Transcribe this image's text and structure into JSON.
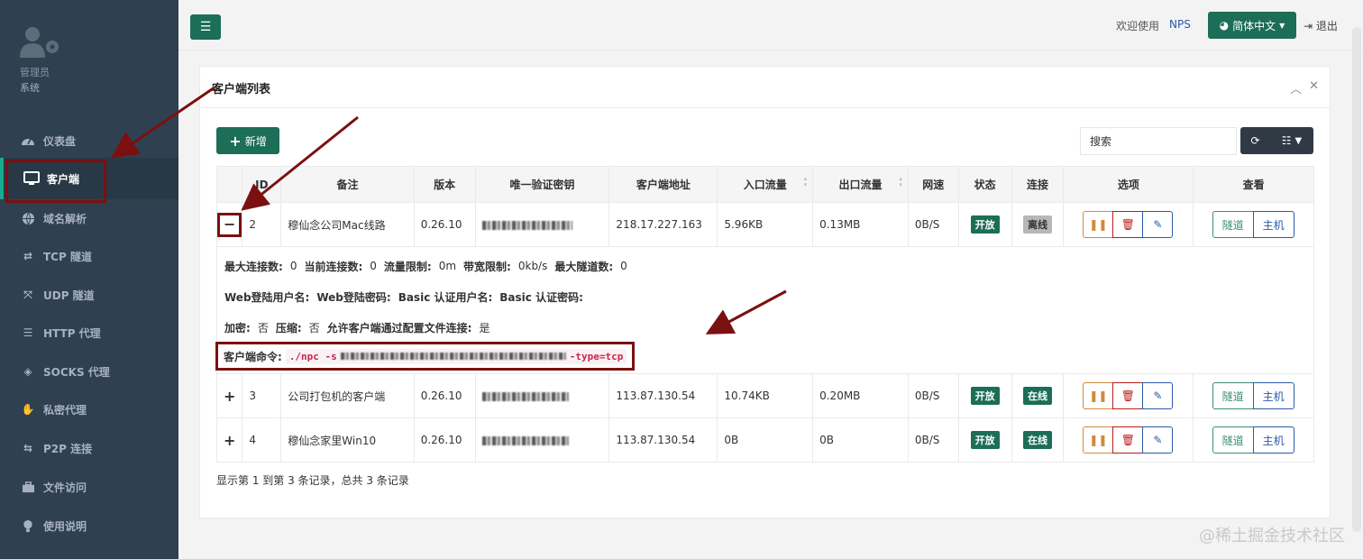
{
  "sidebar": {
    "profile_line1": "管理员",
    "profile_line2": "系统",
    "items": [
      {
        "label": "仪表盘",
        "icon": "dashboard-icon"
      },
      {
        "label": "客户端",
        "icon": "monitor-icon"
      },
      {
        "label": "域名解析",
        "icon": "globe-icon"
      },
      {
        "label": "TCP 隧道",
        "icon": "exchange-icon"
      },
      {
        "label": "UDP 隧道",
        "icon": "arrows-icon"
      },
      {
        "label": "HTTP 代理",
        "icon": "list-icon"
      },
      {
        "label": "SOCKS 代理",
        "icon": "layers-icon"
      },
      {
        "label": "私密代理",
        "icon": "handshake-icon"
      },
      {
        "label": "P2P 连接",
        "icon": "swap-icon"
      },
      {
        "label": "文件访问",
        "icon": "briefcase-icon"
      },
      {
        "label": "使用说明",
        "icon": "bulb-icon"
      }
    ]
  },
  "topbar": {
    "welcome": "欢迎使用",
    "brand": "NPS",
    "language": "简体中文",
    "logout": "退出"
  },
  "panel": {
    "title": "客户端列表",
    "add_label": "新增",
    "search_placeholder": "搜索"
  },
  "table": {
    "headers": [
      "ID",
      "备注",
      "版本",
      "唯一验证密钥",
      "客户端地址",
      "入口流量",
      "出口流量",
      "网速",
      "状态",
      "连接",
      "选项",
      "查看"
    ],
    "rows": [
      {
        "toggle": "−",
        "id": "2",
        "remark": "穆仙念公司Mac线路",
        "version": "0.26.10",
        "address": "218.17.227.163",
        "in_flow": "5.96KB",
        "out_flow": "0.13MB",
        "speed": "0B/S",
        "status": "开放",
        "conn": "离线"
      },
      {
        "toggle": "+",
        "id": "3",
        "remark": "公司打包机的客户端",
        "version": "0.26.10",
        "address": "113.87.130.54",
        "in_flow": "10.74KB",
        "out_flow": "0.20MB",
        "speed": "0B/S",
        "status": "开放",
        "conn": "在线"
      },
      {
        "toggle": "+",
        "id": "4",
        "remark": "穆仙念家里Win10",
        "version": "0.26.10",
        "address": "113.87.130.54",
        "in_flow": "0B",
        "out_flow": "0B",
        "speed": "0B/S",
        "status": "开放",
        "conn": "在线"
      }
    ],
    "view_tunnel": "隧道",
    "view_host": "主机"
  },
  "detail": {
    "line1": [
      {
        "k": "最大连接数:",
        "v": "0"
      },
      {
        "k": "当前连接数:",
        "v": "0"
      },
      {
        "k": "流量限制:",
        "v": "0m"
      },
      {
        "k": "带宽限制:",
        "v": "0kb/s"
      },
      {
        "k": "最大隧道数:",
        "v": "0"
      }
    ],
    "line2": [
      {
        "k": "Web登陆用户名:",
        "v": ""
      },
      {
        "k": "Web登陆密码:",
        "v": ""
      },
      {
        "k": "Basic 认证用户名:",
        "v": ""
      },
      {
        "k": "Basic 认证密码:",
        "v": ""
      }
    ],
    "line3": [
      {
        "k": "加密:",
        "v": "否"
      },
      {
        "k": "压缩:",
        "v": "否"
      },
      {
        "k": "允许客户端通过配置文件连接:",
        "v": "是"
      }
    ],
    "cmd_label": "客户端命令:",
    "cmd_prefix": "./npc -s",
    "cmd_suffix": "-type=tcp"
  },
  "footer": "显示第 1 到第 3 条记录，总共 3 条记录",
  "watermark": "@稀土掘金技术社区",
  "colors": {
    "sidebar": "#2f4050",
    "primary": "#1c6e56",
    "annotation": "#7b1010"
  }
}
